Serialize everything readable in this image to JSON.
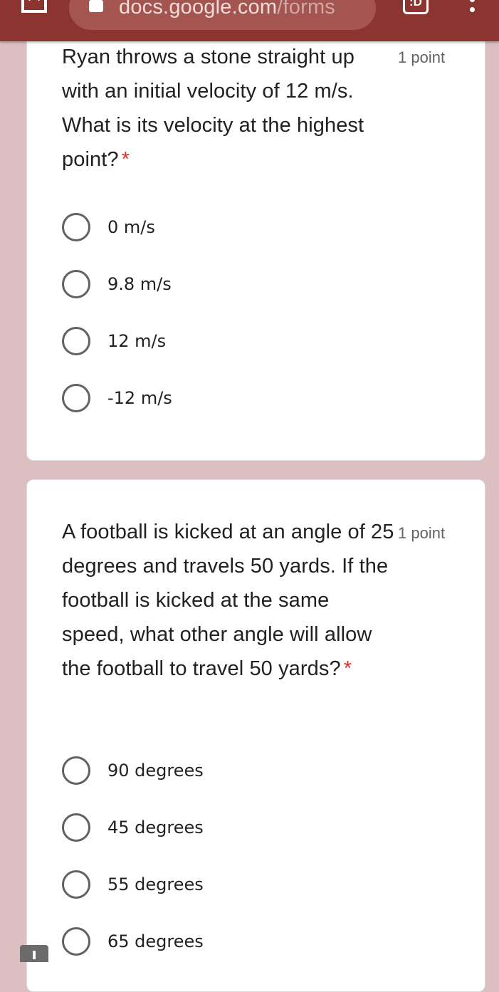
{
  "browser": {
    "url_main": "docs.google.com",
    "url_path": "/forms",
    "tab_count": ":D",
    "icons": {
      "home": "home-icon",
      "lock": "lock-icon",
      "tabs": "tab-switcher-icon",
      "menu": "more-vert-icon"
    }
  },
  "questions": [
    {
      "title": "Ryan throws a stone straight up with an initial velocity of 12 m/s. What is its velocity at the highest point?",
      "required_mark": "*",
      "points": "1 point",
      "options": [
        "0 m/s",
        "9.8 m/s",
        "12 m/s",
        "-12 m/s"
      ]
    },
    {
      "title": "A football is kicked at an angle of 25 degrees and travels 50 yards. If the football is kicked at the same speed, what other angle will allow the football to travel 50 yards?",
      "required_mark": "*",
      "points": "1 point",
      "options": [
        "90 degrees",
        "45 degrees",
        "55 degrees",
        "65 degrees"
      ]
    }
  ],
  "colors": {
    "toolbar": "#8c3530",
    "page_background": "#dcbfc0",
    "required": "#d93025",
    "radio_border": "#5f6368"
  }
}
